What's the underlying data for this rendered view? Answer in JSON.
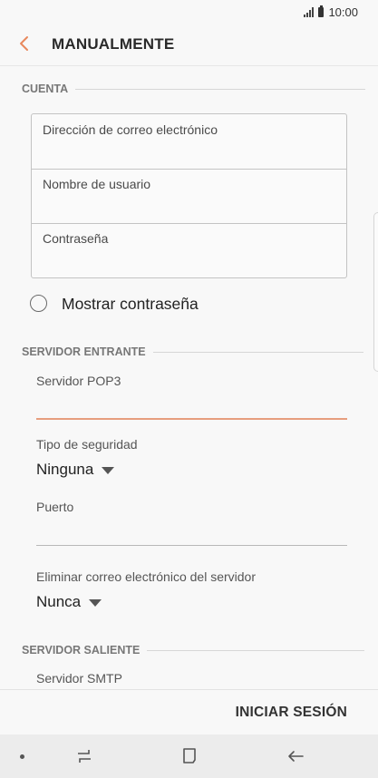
{
  "status_bar": {
    "time": "10:00"
  },
  "header": {
    "title": "MANUALMENTE"
  },
  "cuenta": {
    "section_label": "CUENTA",
    "fields": [
      {
        "label": "Dirección de correo electrónico"
      },
      {
        "label": "Nombre de usuario"
      },
      {
        "label": "Contraseña"
      }
    ],
    "show_password_label": "Mostrar contraseña"
  },
  "incoming": {
    "section_label": "SERVIDOR ENTRANTE",
    "server_label": "Servidor POP3",
    "security_label": "Tipo de seguridad",
    "security_value": "Ninguna",
    "port_label": "Puerto",
    "delete_label": "Eliminar correo electrónico del servidor",
    "delete_value": "Nunca"
  },
  "outgoing": {
    "section_label": "SERVIDOR SALIENTE",
    "server_label": "Servidor SMTP"
  },
  "action_bar": {
    "signin_label": "INICIAR SESIÓN"
  },
  "colors": {
    "accent": "#e8885c",
    "focus_underline": "#e79e7e"
  },
  "nav_icons": [
    "dot-icon",
    "recent-apps-icon",
    "home-icon",
    "back-arrow-icon"
  ]
}
